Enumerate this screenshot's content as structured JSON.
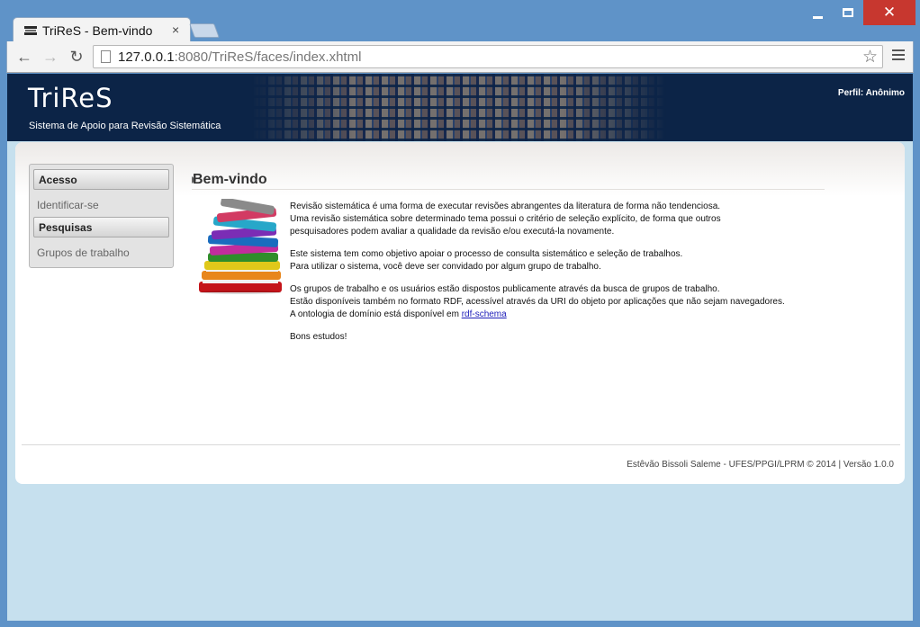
{
  "browser": {
    "tab_title": "TriReS - Bem-vindo",
    "tab_close": "×",
    "url_host": "127.0.0.1",
    "url_rest": ":8080/TriReS/faces/index.xhtml",
    "back": "←",
    "forward": "→",
    "reload": "↻",
    "star": "☆",
    "window_close": "✕"
  },
  "header": {
    "logo": "TriReS",
    "tagline": "Sistema de Apoio para Revisão Sistemática",
    "profile": "Perfil: Anônimo"
  },
  "sidebar": {
    "sections": [
      {
        "header": "Acesso",
        "link": "Identificar-se"
      },
      {
        "header": "Pesquisas",
        "link": "Grupos de trabalho"
      }
    ]
  },
  "main": {
    "title": "Bem-vindo",
    "paragraphs": [
      [
        "Revisão sistemática é uma forma de executar revisões abrangentes da literatura de forma não tendenciosa.",
        "Uma revisão sistemática sobre determinado tema possui o critério de seleção explícito, de forma que outros",
        "pesquisadores podem avaliar a qualidade da revisão e/ou executá-la novamente."
      ],
      [
        "Este sistema tem como objetivo apoiar o processo de consulta sistemático e seleção de trabalhos.",
        "Para utilizar o sistema, você deve ser convidado por algum grupo de trabalho."
      ],
      [
        "Os grupos de trabalho e os usuários estão dispostos publicamente através da busca de grupos de trabalho.",
        "Estão disponíveis também no formato RDF, acessível através da URI do objeto por aplicações que não sejam navegadores."
      ]
    ],
    "ontology_prefix": "A ontologia de domínio está disponível em ",
    "ontology_link": "rdf-schema",
    "closing": "Bons estudos!"
  },
  "footer": {
    "text": "Estêvão Bissoli Saleme - UFES/PPGI/LPRM © 2014 | Versão 1.0.0"
  },
  "colors": {
    "header_bg": "#0c2447",
    "page_bg": "#c6e0ee",
    "window_frame": "#5f93c8",
    "close_button": "#c7372f",
    "link": "#1b1bb8"
  },
  "icons": [
    "favicon-icon",
    "page-icon",
    "star-icon",
    "menu-icon",
    "books-icon"
  ]
}
